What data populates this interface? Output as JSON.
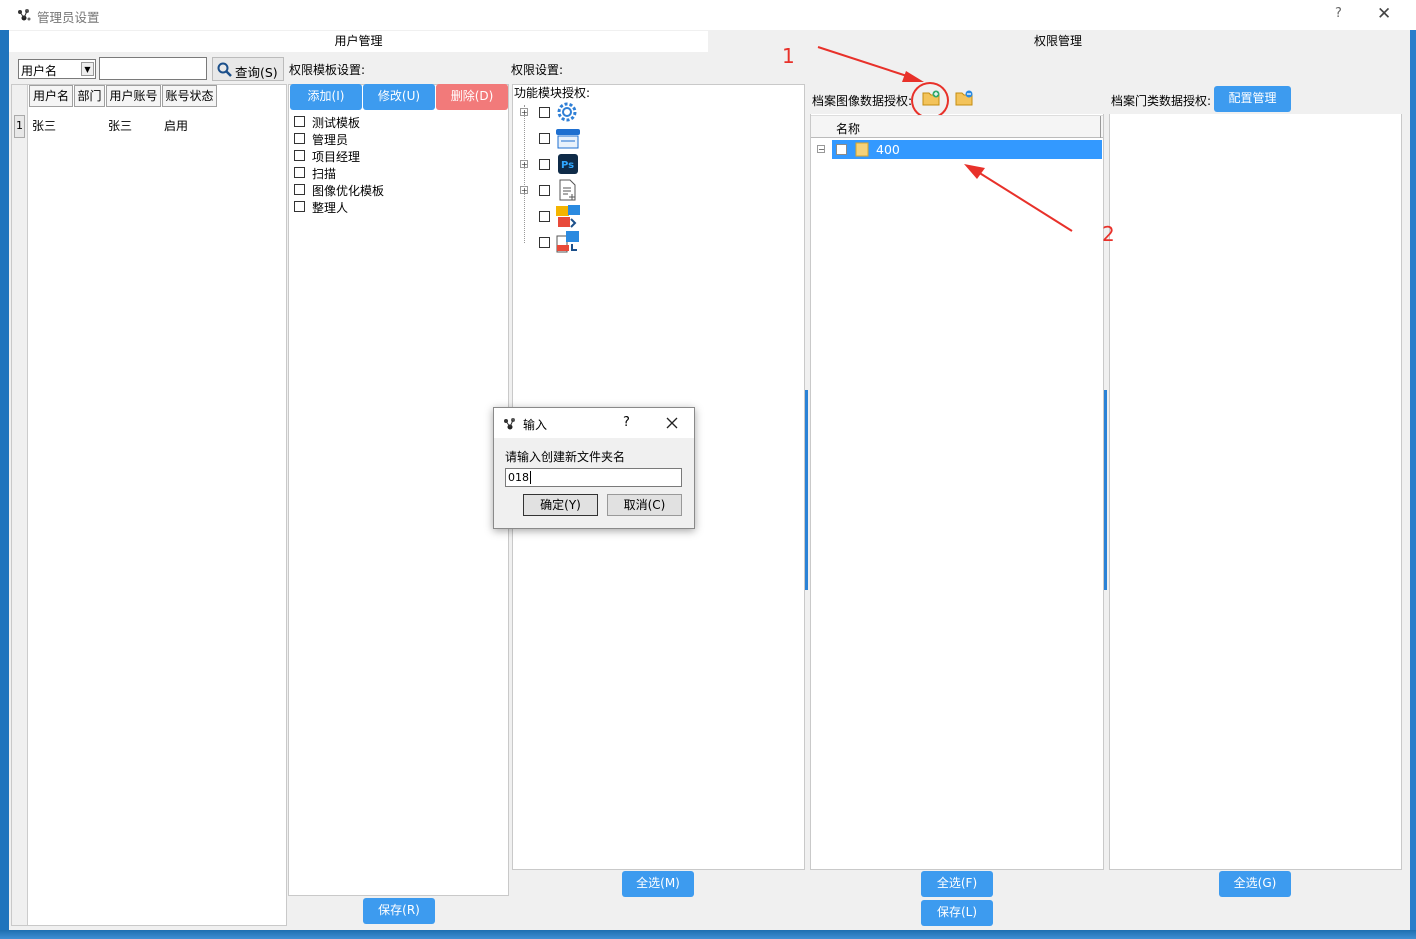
{
  "window": {
    "title": "管理员设置",
    "help": "?",
    "close": "✕"
  },
  "tabs": [
    {
      "label": "用户管理"
    },
    {
      "label": "权限管理"
    }
  ],
  "user_panel": {
    "search_field": "用户名",
    "search_value": "",
    "query_button": "查询(S)",
    "columns": [
      "用户名",
      "部门",
      "用户账号",
      "账号状态"
    ],
    "rows": [
      {
        "index": "1",
        "name": "张三",
        "dept": "",
        "account": "张三",
        "status": "启用"
      }
    ]
  },
  "template_panel": {
    "label": "权限模板设置:",
    "add": "添加(I)",
    "edit": "修改(U)",
    "delete": "删除(D)",
    "templates": [
      "测试模板",
      "管理员",
      "项目经理",
      "扫描",
      "图像优化模板",
      "整理人"
    ],
    "save": "保存(R)"
  },
  "permission_panel": {
    "label": "权限设置:",
    "module_label": "功能模块授权:",
    "modules": [
      {
        "icon": "gear-icon",
        "expandable": true
      },
      {
        "icon": "scanner-icon",
        "expandable": false
      },
      {
        "icon": "photoshop-icon",
        "expandable": true
      },
      {
        "icon": "document-icon",
        "expandable": true
      },
      {
        "icon": "ofd-convert-icon",
        "expandable": false
      },
      {
        "icon": "ofd-export-icon",
        "expandable": false
      }
    ],
    "select_all": "全选(M)"
  },
  "archive_image_panel": {
    "label": "档案图像数据授权:",
    "column": "名称",
    "nodes": [
      {
        "name": "400",
        "selected": true
      }
    ],
    "select_all": "全选(F)",
    "save": "保存(L)"
  },
  "archive_category_panel": {
    "label": "档案门类数据授权:",
    "config": "配置管理",
    "select_all": "全选(G)"
  },
  "annotations": [
    "1",
    "2"
  ],
  "dialog": {
    "title": "输入",
    "help": "?",
    "prompt": "请输入创建新文件夹名",
    "value": "018",
    "ok": "确定(Y)",
    "cancel": "取消(C)"
  },
  "colors": {
    "accent": "#3d9bef",
    "danger": "#f27a7a",
    "annotation": "#e8312a",
    "selection": "#3399ff"
  }
}
